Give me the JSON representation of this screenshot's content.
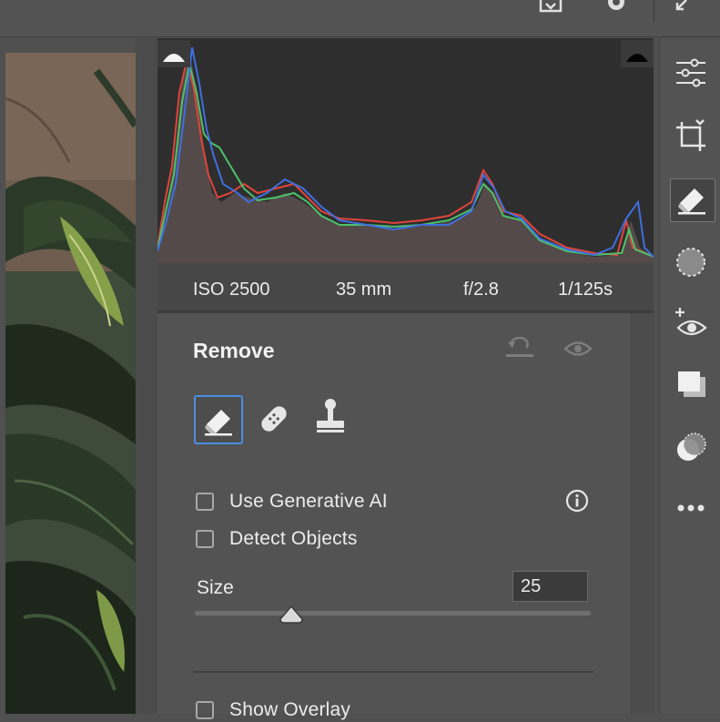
{
  "colors": {
    "accent": "#4a8fe0",
    "histogram_red": "#e0443a",
    "histogram_green": "#4cc26a",
    "histogram_blue": "#3f6fe0"
  },
  "top_bar": {
    "icons": [
      "save-icon",
      "gear-icon",
      "collapse-icon"
    ]
  },
  "histogram": {
    "clip_shadow_icon": "shadow-clipping-warning",
    "clip_highlight_icon": "highlight-clipping-warning"
  },
  "metadata": {
    "iso": "ISO 2500",
    "focal_length": "35 mm",
    "aperture": "f/2.8",
    "shutter": "1/125s"
  },
  "remove_panel": {
    "title": "Remove",
    "header_icons": [
      "reset-icon",
      "visibility-eye-icon"
    ],
    "tools": [
      {
        "name": "eraser-remove-tool",
        "selected": true
      },
      {
        "name": "heal-bandage-tool",
        "selected": false
      },
      {
        "name": "clone-stamp-tool",
        "selected": false
      }
    ],
    "use_generative_ai": {
      "label": "Use Generative AI",
      "checked": false
    },
    "detect_objects": {
      "label": "Detect Objects",
      "checked": false
    },
    "size": {
      "label": "Size",
      "value": "25"
    },
    "show_overlay": {
      "label": "Show Overlay",
      "checked": false
    }
  },
  "right_toolbar": {
    "items": [
      "edit-sliders-icon",
      "crop-icon",
      "remove-eraser-icon",
      "masking-icon",
      "red-eye-icon",
      "presets-icon",
      "snapshots-icon",
      "more-icon"
    ]
  }
}
